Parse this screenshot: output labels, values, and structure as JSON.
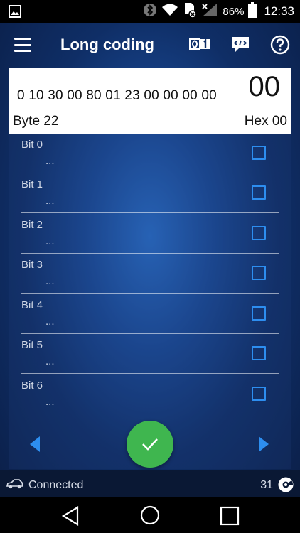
{
  "status_bar": {
    "battery": "86%",
    "time": "12:33"
  },
  "toolbar": {
    "title": "Long coding"
  },
  "coding": {
    "bytes": "0 10 30 00 80 01 23 00 00 00 00",
    "current_byte_value": "00",
    "byte_label": "Byte 22",
    "hex_label": "Hex 00"
  },
  "bits": [
    {
      "label": "Bit 0",
      "value": "..."
    },
    {
      "label": "Bit 1",
      "value": "..."
    },
    {
      "label": "Bit 2",
      "value": "..."
    },
    {
      "label": "Bit 3",
      "value": "..."
    },
    {
      "label": "Bit 4",
      "value": "..."
    },
    {
      "label": "Bit 5",
      "value": "..."
    },
    {
      "label": "Bit 6",
      "value": "..."
    }
  ],
  "footer": {
    "connection": "Connected",
    "count": "31"
  },
  "colors": {
    "accent": "#2d8ef0",
    "confirm": "#3fb64f",
    "panel_bg": "#1a4a96"
  },
  "icons": {
    "status_left": "gallery-icon",
    "bluetooth": "bluetooth-icon",
    "wifi": "wifi-icon",
    "sim": "sim-icon",
    "signal": "signal-icon",
    "battery": "battery-icon",
    "menu": "menu-icon",
    "binary": "binary-icon",
    "code": "code-icon",
    "help": "help-icon",
    "prev": "arrow-left-icon",
    "next": "arrow-right-icon",
    "confirm": "check-icon",
    "car": "car-icon",
    "gauge": "gauge-icon"
  }
}
